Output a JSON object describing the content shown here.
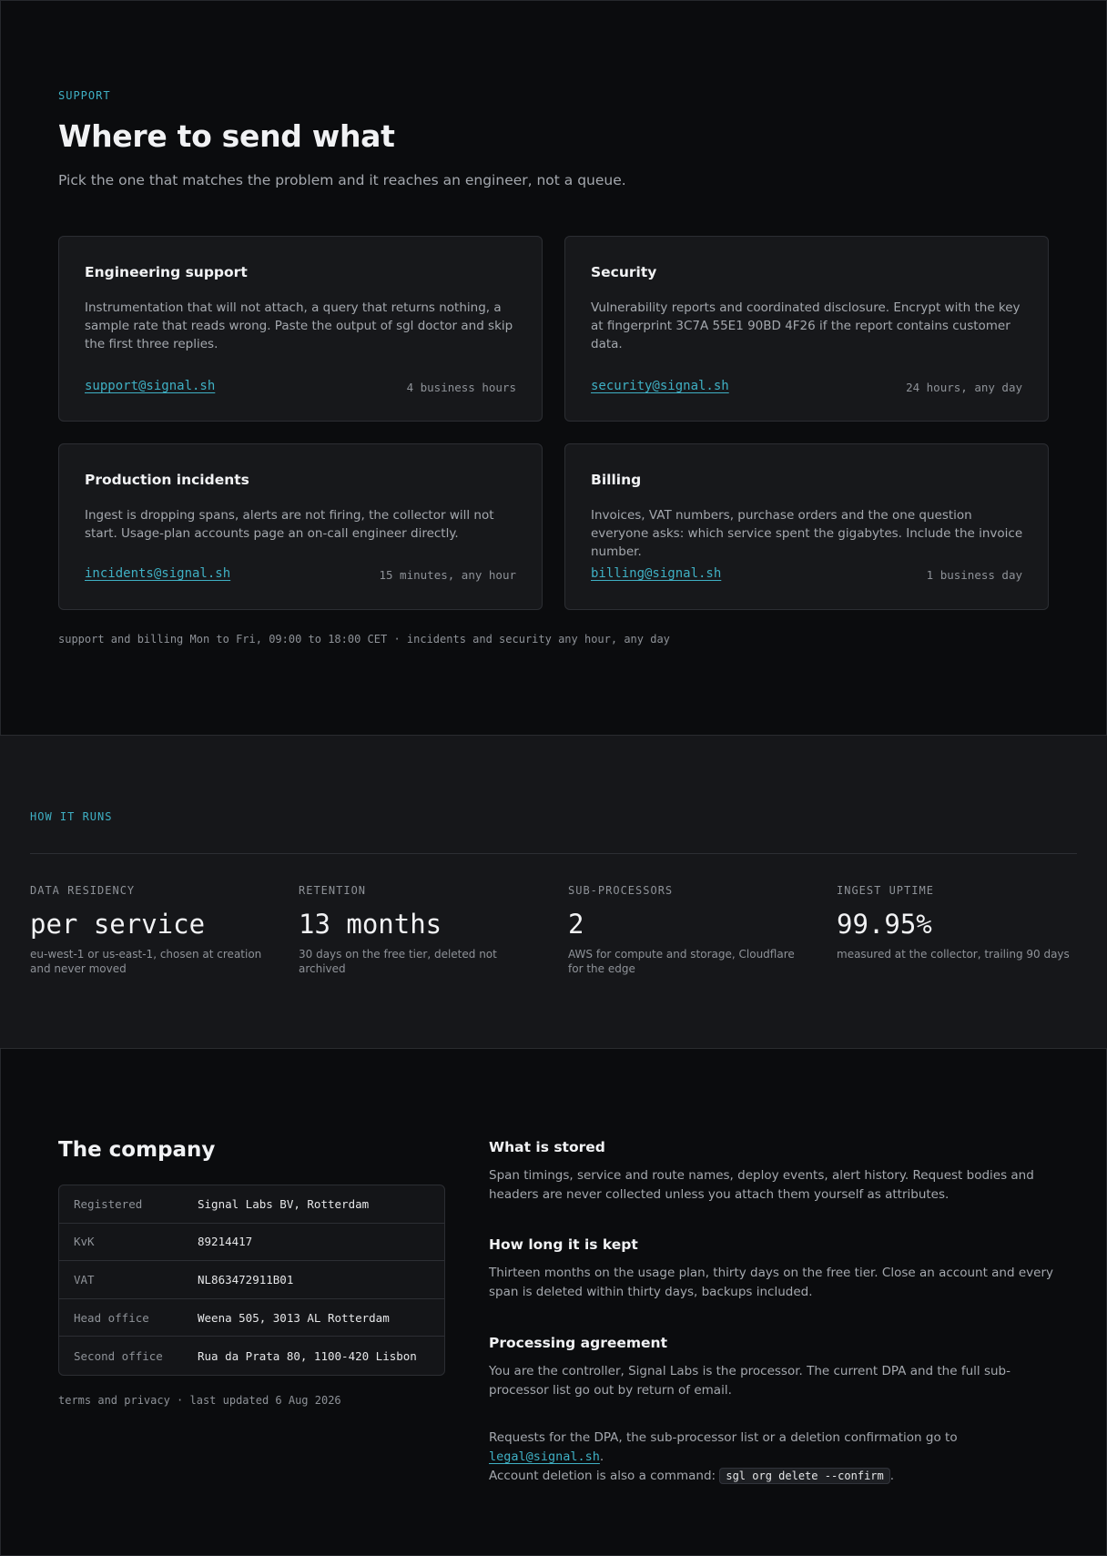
{
  "support": {
    "eyebrow": "SUPPORT",
    "title": "Where to send what",
    "lede": "Pick the one that matches the problem and it reaches an engineer, not a queue.",
    "cards": [
      {
        "title": "Engineering support",
        "body": "Instrumentation that will not attach, a query that returns nothing, a sample rate that reads wrong. Paste the output of sgl doctor and skip the first three replies.",
        "email": "support@signal.sh",
        "response": "4 business hours"
      },
      {
        "title": "Security",
        "body": "Vulnerability reports and coordinated disclosure. Encrypt with the key at fingerprint 3C7A 55E1 90BD 4F26 if the report contains customer data.",
        "email": "security@signal.sh",
        "response": "24 hours, any day"
      },
      {
        "title": "Production incidents",
        "body": "Ingest is dropping spans, alerts are not firing, the collector will not start. Usage-plan accounts page an on-call engineer directly.",
        "email": "incidents@signal.sh",
        "response": "15 minutes, any hour"
      },
      {
        "title": "Billing",
        "body": "Invoices, VAT numbers, purchase orders and the one question everyone asks: which service spent the gigabytes. Include the invoice number.",
        "email": "billing@signal.sh",
        "response": "1 business day"
      }
    ],
    "hours_note": "support and billing Mon to Fri, 09:00 to 18:00 CET · incidents and security any hour, any day"
  },
  "runs": {
    "eyebrow": "HOW IT RUNS",
    "stats": [
      {
        "label": "DATA RESIDENCY",
        "value": "per service",
        "desc": "eu-west-1 or us-east-1, chosen at creation and never moved"
      },
      {
        "label": "RETENTION",
        "value": "13 months",
        "desc": "30 days on the free tier, deleted not archived"
      },
      {
        "label": "SUB-PROCESSORS",
        "value": "2",
        "desc": "AWS for compute and storage, Cloudflare for the edge"
      },
      {
        "label": "INGEST UPTIME",
        "value": "99.95%",
        "desc": "measured at the collector, trailing 90 days"
      }
    ]
  },
  "company": {
    "title": "The company",
    "facts": [
      {
        "key": "Registered",
        "value": "Signal Labs BV, Rotterdam"
      },
      {
        "key": "KvK",
        "value": "89214417"
      },
      {
        "key": "VAT",
        "value": "NL863472911B01"
      },
      {
        "key": "Head office",
        "value": "Weena 505, 3013 AL Rotterdam"
      },
      {
        "key": "Second office",
        "value": "Rua da Prata 80, 1100-420 Lisbon"
      }
    ],
    "legal_note": "terms and privacy · last updated 6 Aug 2026",
    "sections": [
      {
        "title": "What is stored",
        "body": "Span timings, service and route names, deploy events, alert history. Request bodies and headers are never collected unless you attach them yourself as attributes."
      },
      {
        "title": "How long it is kept",
        "body": "Thirteen months on the usage plan, thirty days on the free tier. Close an account and every span is deleted within thirty days, backups included."
      },
      {
        "title": "Processing agreement",
        "body": "You are the controller, Signal Labs is the processor. The current DPA and the full sub-processor list go out by return of email."
      }
    ],
    "requests": {
      "prefix": "Requests for the DPA, the sub-processor list or a deletion confirmation go to ",
      "email": "legal@signal.sh",
      "after_email": ".",
      "line2": "Account deletion is also a command: ",
      "command": "sgl org delete --confirm",
      "end": "."
    }
  }
}
